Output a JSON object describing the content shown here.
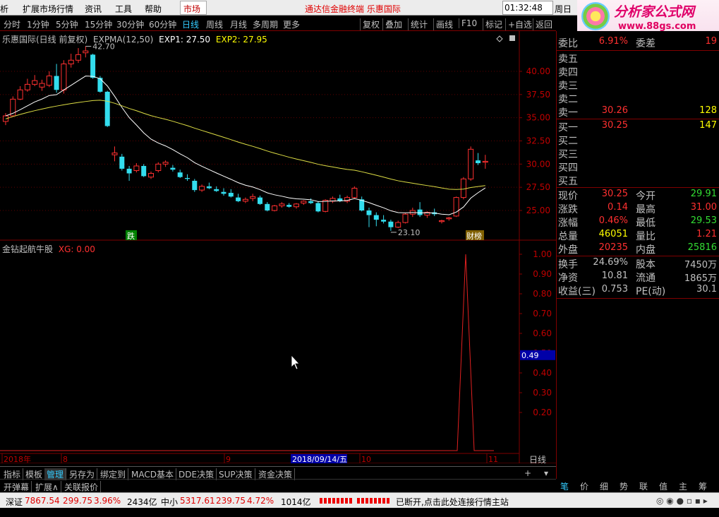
{
  "menubar": {
    "items": [
      "析",
      "扩展市场行情",
      "资讯",
      "工具",
      "帮助"
    ],
    "market": "市场",
    "brand": "通达信金融终端 乐惠国际",
    "time": "01:32:48",
    "weekday": "周日"
  },
  "logo": {
    "title": "分析家公式网",
    "url": "www.88gs.com"
  },
  "periods": [
    "分时",
    "1分钟",
    "5分钟",
    "15分钟",
    "30分钟",
    "60分钟",
    "日线",
    "周线",
    "月线",
    "多周期",
    "更多"
  ],
  "selected_period": "日线",
  "actions": [
    "复权",
    "叠加",
    "统计",
    "画线",
    "F10",
    "标记",
    "+自选",
    "返回"
  ],
  "info": {
    "name": "乐惠国际(日线 前复权)",
    "ind": "EXPMA(12,50)",
    "exp1": "EXP1: 27.50",
    "exp2": "EXP2: 27.95"
  },
  "indicator": {
    "name": "金钻起航牛股",
    "xg": "XG: 0.00"
  },
  "chart_data": {
    "type": "candlestick",
    "price_axis": [
      "40.00",
      "37.50",
      "35.00",
      "32.50",
      "30.00",
      "27.50",
      "25.00"
    ],
    "ind_axis": [
      "1.00",
      "0.90",
      "0.80",
      "0.70",
      "0.60",
      "0.50",
      "0.40",
      "0.30",
      "0.20"
    ],
    "ind_current": "0.49",
    "high_label": "42.70",
    "low_label": "23.10",
    "markers": [
      "跌",
      "财榜"
    ],
    "x_labels": [
      "2018年",
      "8",
      "9",
      "10",
      "11"
    ],
    "cursor_date": "2018/09/14/五",
    "period_label": "日线",
    "ylim": [
      22.5,
      43.5
    ]
  },
  "tabs1": [
    "指标",
    "模板",
    "管理",
    "另存为",
    "绑定到",
    "MACD基本",
    "DDE决策",
    "SUP决策",
    "资金决策"
  ],
  "tabs1_active": "管理",
  "tabs2": [
    "开弹幕",
    "扩展∧",
    "关联报价"
  ],
  "status": {
    "sz_label": "深证",
    "sz_val": "7867.54",
    "sz_chg": "299.75",
    "sz_pct": "3.96%",
    "sz_amt": "2434亿",
    "zx_label": "中小",
    "zx_val": "5317.61",
    "zx_chg": "239.75",
    "zx_pct": "4.72%",
    "zx_amt": "1014亿",
    "msg": "已断开,点击此处连接行情主站"
  },
  "quote": {
    "wb": {
      "lbl": "委比",
      "val": "6.91%",
      "lbl2": "委差",
      "val2": "19"
    },
    "sells": [
      {
        "lbl": "卖五",
        "val": "",
        "vol": ""
      },
      {
        "lbl": "卖四",
        "val": "",
        "vol": ""
      },
      {
        "lbl": "卖三",
        "val": "",
        "vol": ""
      },
      {
        "lbl": "卖二",
        "val": "",
        "vol": ""
      },
      {
        "lbl": "卖一",
        "val": "30.26",
        "vol": "128"
      }
    ],
    "buys": [
      {
        "lbl": "买一",
        "val": "30.25",
        "vol": "147"
      },
      {
        "lbl": "买二",
        "val": "",
        "vol": ""
      },
      {
        "lbl": "买三",
        "val": "",
        "vol": ""
      },
      {
        "lbl": "买四",
        "val": "",
        "vol": ""
      },
      {
        "lbl": "买五",
        "val": "",
        "vol": ""
      }
    ],
    "stats": [
      {
        "lbl": "现价",
        "val": "30.25",
        "lbl2": "今开",
        "val2": "29.91"
      },
      {
        "lbl": "涨跌",
        "val": "0.14",
        "lbl2": "最高",
        "val2": "31.00"
      },
      {
        "lbl": "涨幅",
        "val": "0.46%",
        "lbl2": "最低",
        "val2": "29.53"
      },
      {
        "lbl": "总量",
        "val": "46051",
        "lbl2": "量比",
        "val2": "1.21"
      },
      {
        "lbl": "外盘",
        "val": "20235",
        "lbl2": "内盘",
        "val2": "25816"
      }
    ],
    "fin": [
      {
        "lbl": "换手",
        "val": "24.69%",
        "lbl2": "股本",
        "val2": "7450万"
      },
      {
        "lbl": "净资",
        "val": "10.81",
        "lbl2": "流通",
        "val2": "1865万"
      },
      {
        "lbl": "收益(三)",
        "val": "0.753",
        "lbl2": "PE(动)",
        "val2": "30.1"
      }
    ]
  },
  "rtabs": [
    "笔",
    "价",
    "细",
    "势",
    "联",
    "值",
    "主",
    "筹"
  ],
  "colors": {
    "up": "#ff3030",
    "down": "#33ddee",
    "exp1": "#ffffff",
    "exp2": "#dddd44"
  }
}
